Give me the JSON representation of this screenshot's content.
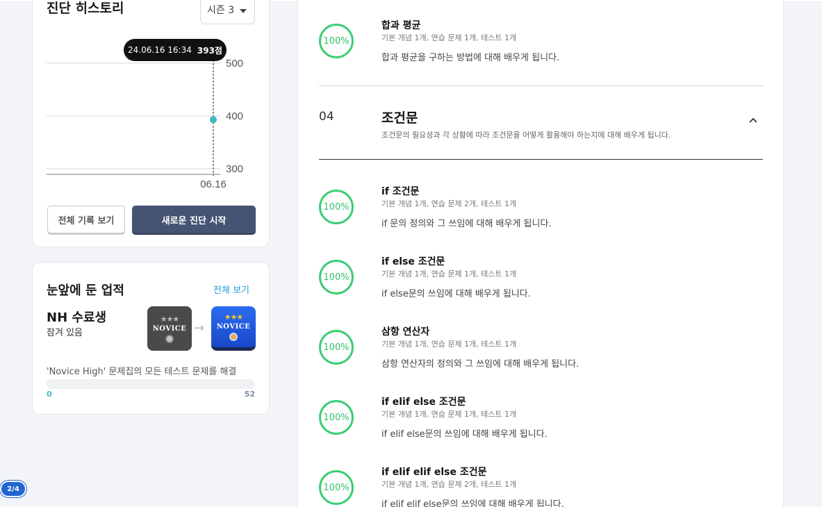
{
  "history": {
    "title": "진단 히스토리",
    "season": "시즌 3",
    "chart_data": {
      "type": "line",
      "x": [
        "06.16"
      ],
      "series": [
        {
          "values": [
            393
          ]
        }
      ],
      "y_ticks": [
        500,
        400,
        300
      ],
      "ylim": [
        290,
        520
      ],
      "x_tick_labels": [
        "06.16"
      ],
      "tooltip": {
        "date": "24.06.16 16:34",
        "score": "393점"
      },
      "grid": true
    },
    "btn_all": "전체 기록 보기",
    "btn_new": "새로운 진단 시작"
  },
  "achievement": {
    "title": "눈앞에 둔 업적",
    "view_all": "전체 보기",
    "name": "NH 수료생",
    "status": "잠겨 있음",
    "badge_locked_text": "NOVICE",
    "badge_unlocked_text": "NOVICE",
    "badge_stars": "★★★",
    "arrow": "→",
    "description": "'Novice High' 문제집의 모든 테스트 문제를 해결",
    "progress_fraction": 0,
    "progress_min": "0",
    "progress_max": "52"
  },
  "page_indicator": "2/4",
  "colors": {
    "accent_green": "#3ccd74",
    "accent_teal": "#3fc3c6",
    "navy_button": "#455472",
    "link_blue": "#1e9bd7"
  },
  "icons": {
    "section_toggle": "chevron-up-icon",
    "badge_arrow": "arrow-right-icon"
  },
  "lessons_top": [
    {
      "progress": "100%",
      "title": "합과 평균",
      "meta": "기본 개념 1개, 연습 문제 1개, 테스트 1개",
      "desc": "합과 평균을 구하는 방법에 대해 배우게 됩니다."
    }
  ],
  "section": {
    "number": "04",
    "title": "조건문",
    "desc": "조건문의 필요성과 각 상황에 따라 조건문을 어떻게 활용해야 하는지에 대해 배우게 됩니다."
  },
  "lessons": [
    {
      "progress": "100%",
      "title": "if 조건문",
      "meta": "기본 개념 1개, 연습 문제 2개, 테스트 1개",
      "desc": "if 문의 정의와 그 쓰임에 대해 배우게 됩니다."
    },
    {
      "progress": "100%",
      "title": "if else 조건문",
      "meta": "기본 개념 1개, 연습 문제 1개, 테스트 1개",
      "desc": "if else문의 쓰임에 대해 배우게 됩니다."
    },
    {
      "progress": "100%",
      "title": "삼항 연산자",
      "meta": "기본 개념 1개, 연습 문제 1개, 테스트 1개",
      "desc": "삼항 연산자의 정의와 그 쓰임에 대해 배우게 됩니다."
    },
    {
      "progress": "100%",
      "title": "if elif else 조건문",
      "meta": "기본 개념 1개, 연습 문제 1개, 테스트 1개",
      "desc": "if elif else문의 쓰임에 대해 배우게 됩니다."
    },
    {
      "progress": "100%",
      "title": "if elif elif else 조건문",
      "meta": "기본 개념 1개, 연습 문제 2개, 테스트 1개",
      "desc": "if elif elif else문의 쓰임에 대해 배우게 됩니다."
    }
  ]
}
